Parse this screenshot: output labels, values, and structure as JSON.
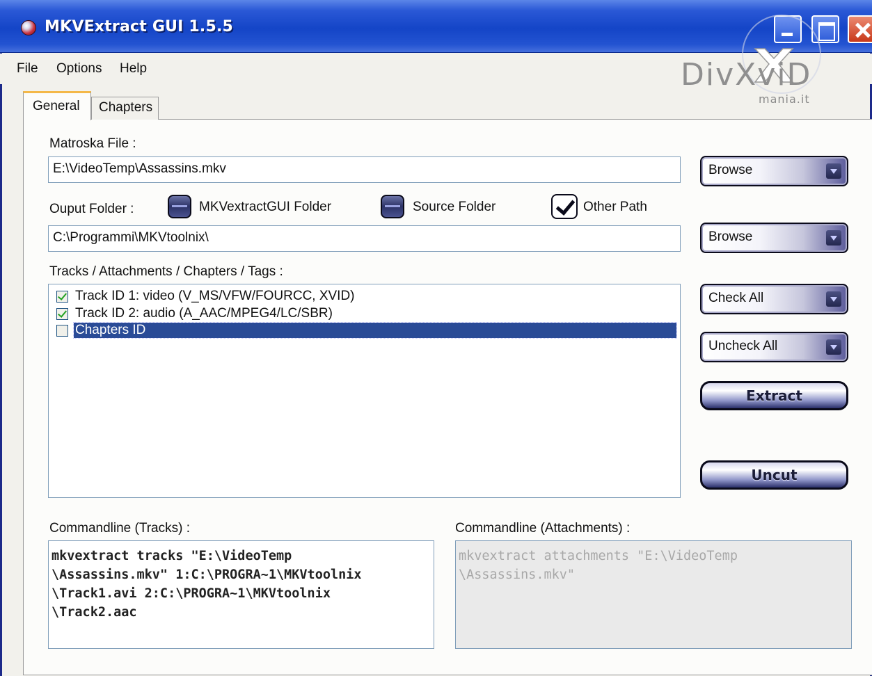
{
  "window": {
    "title": "MKVExtract GUI 1.5.5"
  },
  "menu": [
    "File",
    "Options",
    "Help"
  ],
  "watermark": {
    "brand": "DivXviD",
    "sub": "mania.it"
  },
  "tabs": [
    {
      "label": "General",
      "active": true
    },
    {
      "label": "Chapters",
      "active": false
    }
  ],
  "general": {
    "matroska_label": "Matroska File :",
    "matroska_value": "E:\\VideoTemp\\Assassins.mkv",
    "output_label": "Ouput Folder :",
    "output_options": [
      {
        "label": "MKVextractGUI Folder",
        "selected": false
      },
      {
        "label": "Source Folder",
        "selected": false
      },
      {
        "label": "Other Path",
        "selected": true
      }
    ],
    "output_value": "C:\\Programmi\\MKVtoolnix\\",
    "tracks_label": "Tracks / Attachments / Chapters / Tags :",
    "tracks": [
      {
        "label": "Track ID 1: video (V_MS/VFW/FOURCC, XVID)",
        "checked": true,
        "selected": false
      },
      {
        "label": "Track ID 2: audio (A_AAC/MPEG4/LC/SBR)",
        "checked": true,
        "selected": false
      },
      {
        "label": "Chapters ID",
        "checked": false,
        "selected": true
      }
    ],
    "buttons": {
      "browse1": "Browse",
      "browse2": "Browse",
      "check_all": "Check All",
      "uncheck_all": "Uncheck All",
      "extract": "Extract",
      "uncut": "Uncut"
    },
    "cmd_tracks_label": "Commandline (Tracks) :",
    "cmd_tracks": "mkvextract tracks \"E:\\VideoTemp\n\\Assassins.mkv\" 1:C:\\PROGRA~1\\MKVtoolnix\n\\Track1.avi 2:C:\\PROGRA~1\\MKVtoolnix\n\\Track2.aac",
    "cmd_attach_label": "Commandline (Attachments) :",
    "cmd_attach": "mkvextract attachments \"E:\\VideoTemp\n\\Assassins.mkv\""
  },
  "colors": {
    "titlebar": "#1445c7",
    "selection": "#2a4b97",
    "tab_accent": "#f4b848"
  }
}
